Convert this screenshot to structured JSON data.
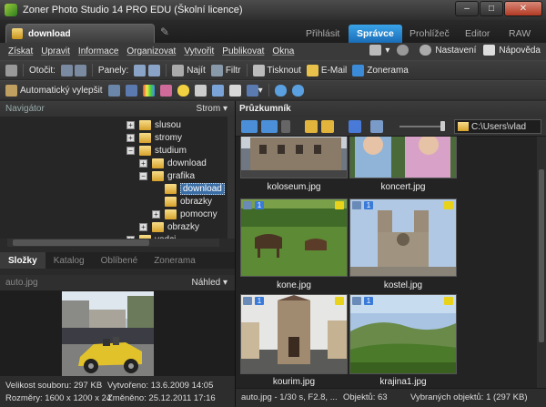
{
  "window": {
    "title": "Zoner Photo Studio 14 PRO EDU (Školní licence)",
    "min": "–",
    "max": "□",
    "close": "✕"
  },
  "doc_tab": {
    "label": "download"
  },
  "mode_tabs": [
    {
      "label": "Přihlásit",
      "active": false
    },
    {
      "label": "Správce",
      "active": true
    },
    {
      "label": "Prohlížeč",
      "active": false
    },
    {
      "label": "Editor",
      "active": false
    },
    {
      "label": "RAW",
      "active": false
    }
  ],
  "menu": [
    "Získat",
    "Upravit",
    "Informace",
    "Organizovat",
    "Vytvořit",
    "Publikovat",
    "Okna"
  ],
  "menu_right": {
    "settings": "Nastavení",
    "help": "Nápověda"
  },
  "toolbar1": {
    "rotate": "Otočit:",
    "panels": "Panely:",
    "find": "Najít",
    "filter": "Filtr",
    "print": "Tisknout",
    "email": "E-Mail",
    "zonerama": "Zonerama"
  },
  "toolbar2": {
    "auto_enhance": "Automatický vylepšit"
  },
  "navigator": {
    "title": "Navigátor",
    "sort": "Strom ▾"
  },
  "tree": [
    "slusou",
    "stromy",
    "studium",
    "download",
    "grafika",
    "download",
    "obrazky",
    "pomocny",
    "obrazky",
    "vedci"
  ],
  "left_tabs": [
    "Složky",
    "Katalog",
    "Oblíbené",
    "Zonerama"
  ],
  "preview": {
    "filename": "auto.jpg",
    "mode": "Náhled ▾"
  },
  "info": {
    "size_label": "Velikost souboru: 297 KB",
    "created_label": "Vytvořeno: 13.6.2009 14:05",
    "dims_label": "Rozměry: 1600 x 1200 x 24",
    "modified_label": "Změněno: 25.12.2011 17:16"
  },
  "explorer": {
    "title": "Průzkumník",
    "path": "C:\\Users\\vlad"
  },
  "thumbs": [
    {
      "name": "koloseum.jpg"
    },
    {
      "name": "koncert.jpg"
    },
    {
      "name": "kone.jpg"
    },
    {
      "name": "kostel.jpg"
    },
    {
      "name": "kourim.jpg"
    },
    {
      "name": "krajina1.jpg"
    }
  ],
  "badge_text": "1",
  "status": {
    "file": "auto.jpg - 1/30 s, F2.8, ...",
    "objects": "Objektů: 63",
    "selected": "Vybraných objektů: 1 (297 KB)"
  },
  "colors": {
    "accent": "#1a6db8",
    "folder": "#e3b43c",
    "background": "#2b2b2b"
  }
}
